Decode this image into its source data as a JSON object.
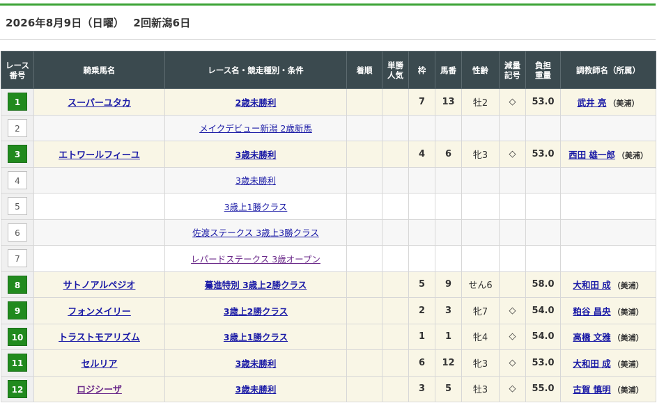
{
  "page": {
    "title": "2026年8月9日（日曜）　 2回新潟6日"
  },
  "table": {
    "headers": {
      "race_no": "レース\n番号",
      "horse": "騎乗馬名",
      "race": "レース名・競走種別・条件",
      "finish": "着順",
      "popularity": "単勝\n人気",
      "frame": "枠",
      "horse_no": "馬番",
      "sex_age": "性齢",
      "weight_mark": "減量\n記号",
      "load": "負担\n重量",
      "trainer": "調教師名（所属）"
    },
    "rows": [
      {
        "race_no": "1",
        "active": true,
        "horse": "スーパーユタカ",
        "race": "2歳未勝利",
        "finish": "",
        "popularity": "",
        "frame": "7",
        "horse_no": "13",
        "sex_age": "牡2",
        "weight_mark": "◇",
        "load": "53.0",
        "trainer": "武井 亮",
        "stable": "（美浦）"
      },
      {
        "race_no": "2",
        "active": false,
        "horse": "",
        "race": "メイクデビュー新潟 2歳新馬",
        "finish": "",
        "popularity": "",
        "frame": "",
        "horse_no": "",
        "sex_age": "",
        "weight_mark": "",
        "load": "",
        "trainer": "",
        "stable": ""
      },
      {
        "race_no": "3",
        "active": true,
        "horse": "エトワールフィーユ",
        "race": "3歳未勝利",
        "finish": "",
        "popularity": "",
        "frame": "4",
        "horse_no": "6",
        "sex_age": "牝3",
        "weight_mark": "◇",
        "load": "53.0",
        "trainer": "西田 雄一郎",
        "stable": "（美浦）"
      },
      {
        "race_no": "4",
        "active": false,
        "horse": "",
        "race": "3歳未勝利",
        "finish": "",
        "popularity": "",
        "frame": "",
        "horse_no": "",
        "sex_age": "",
        "weight_mark": "",
        "load": "",
        "trainer": "",
        "stable": ""
      },
      {
        "race_no": "5",
        "active": false,
        "horse": "",
        "race": "3歳上1勝クラス",
        "finish": "",
        "popularity": "",
        "frame": "",
        "horse_no": "",
        "sex_age": "",
        "weight_mark": "",
        "load": "",
        "trainer": "",
        "stable": ""
      },
      {
        "race_no": "6",
        "active": false,
        "horse": "",
        "race": "佐渡ステークス 3歳上3勝クラス",
        "finish": "",
        "popularity": "",
        "frame": "",
        "horse_no": "",
        "sex_age": "",
        "weight_mark": "",
        "load": "",
        "trainer": "",
        "stable": ""
      },
      {
        "race_no": "7",
        "active": false,
        "horse": "",
        "race": "レパードステークス 3歳オープン",
        "finish": "",
        "popularity": "",
        "frame": "",
        "horse_no": "",
        "sex_age": "",
        "weight_mark": "",
        "load": "",
        "trainer": "",
        "stable": ""
      },
      {
        "race_no": "8",
        "active": true,
        "horse": "サトノアルペジオ",
        "race": "驀進特別 3歳上2勝クラス",
        "finish": "",
        "popularity": "",
        "frame": "5",
        "horse_no": "9",
        "sex_age": "せん6",
        "weight_mark": "",
        "load": "58.0",
        "trainer": "大和田 成",
        "stable": "（美浦）"
      },
      {
        "race_no": "9",
        "active": true,
        "horse": "フォンメイリー",
        "race": "3歳上2勝クラス",
        "finish": "",
        "popularity": "",
        "frame": "2",
        "horse_no": "3",
        "sex_age": "牝7",
        "weight_mark": "◇",
        "load": "54.0",
        "trainer": "粕谷 昌央",
        "stable": "（美浦）"
      },
      {
        "race_no": "10",
        "active": true,
        "horse": "トラストモアリズム",
        "race": "3歳上1勝クラス",
        "finish": "",
        "popularity": "",
        "frame": "1",
        "horse_no": "1",
        "sex_age": "牝4",
        "weight_mark": "◇",
        "load": "54.0",
        "trainer": "高橋 文雅",
        "stable": "（美浦）"
      },
      {
        "race_no": "11",
        "active": true,
        "horse": "セルリア",
        "race": "3歳未勝利",
        "finish": "",
        "popularity": "",
        "frame": "6",
        "horse_no": "12",
        "sex_age": "牝3",
        "weight_mark": "◇",
        "load": "53.0",
        "trainer": "大和田 成",
        "stable": "（美浦）"
      },
      {
        "race_no": "12",
        "active": true,
        "horse": "ロジシーザ",
        "race": "3歳未勝利",
        "finish": "",
        "popularity": "",
        "frame": "3",
        "horse_no": "5",
        "sex_age": "牡3",
        "weight_mark": "◇",
        "load": "55.0",
        "trainer": "古賀 慎明",
        "stable": "（美浦）"
      }
    ]
  }
}
